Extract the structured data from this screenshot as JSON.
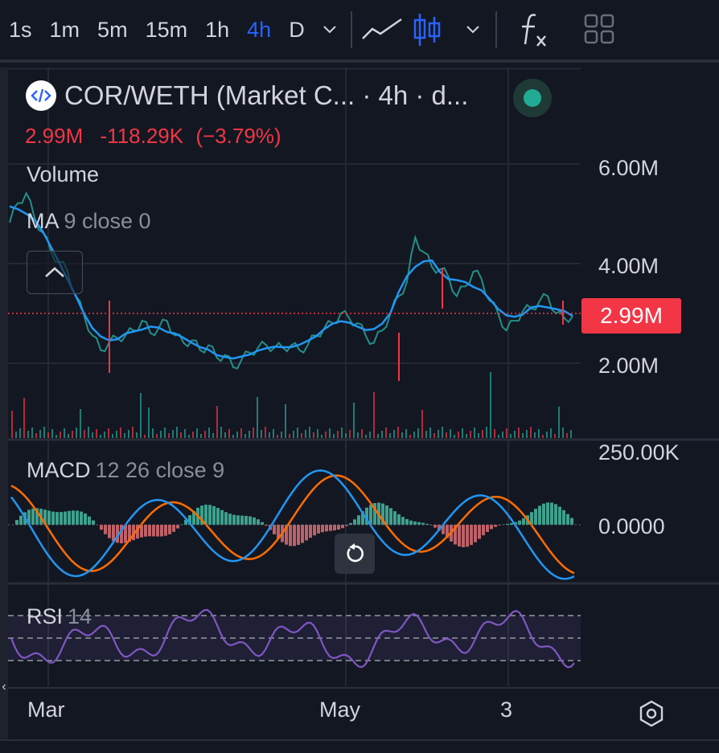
{
  "toolbar": {
    "timeframes": [
      "1s",
      "1m",
      "5m",
      "15m",
      "1h",
      "4h",
      "D"
    ],
    "active_timeframe": "4h"
  },
  "legend": {
    "title": "COR/WETH (Market C... · 4h · d...",
    "price": "2.99M",
    "change": "-118.29K",
    "change_pct": "(−3.79%)"
  },
  "indicators": {
    "volume": {
      "name": "Volume"
    },
    "ma": {
      "name": "MA",
      "params": "9 close 0"
    },
    "macd": {
      "name": "MACD",
      "params": "12 26 close 9"
    },
    "rsi": {
      "name": "RSI",
      "params": "14"
    }
  },
  "price_axis": {
    "ticks": [
      "6.00M",
      "4.00M",
      "2.00M"
    ],
    "current_price": "2.99M",
    "macd_ticks": [
      "250.00K",
      "0.0000"
    ]
  },
  "time_axis": {
    "labels": [
      "Mar",
      "May",
      "3"
    ]
  },
  "colors": {
    "background": "#131722",
    "up": "#26a69a",
    "down": "#f23645",
    "ma_line": "#2196f3",
    "macd_line": "#2196f3",
    "signal_line": "#ff6d00",
    "rsi_line": "#7e57c2",
    "accent": "#2962ff"
  },
  "chart_data": {
    "type": "line",
    "symbol": "COR/WETH",
    "interval": "4h",
    "price_series": {
      "name": "",
      "values": [
        4.9,
        5.3,
        5.5,
        5.0,
        4.7,
        4.3,
        4.1,
        3.9,
        3.4,
        3.0,
        2.6,
        2.3,
        2.45,
        2.55,
        2.6,
        2.7,
        2.9,
        2.65,
        2.75,
        2.9,
        2.6,
        2.45,
        2.5,
        2.3,
        2.4,
        2.15,
        2.2,
        1.95,
        2.1,
        2.25,
        2.35,
        2.4,
        2.35,
        2.35,
        2.4,
        2.3,
        2.4,
        2.6,
        2.75,
        2.85,
        3.05,
        2.95,
        2.85,
        2.6,
        2.45,
        2.7,
        3.05,
        3.4,
        3.7,
        4.6,
        4.3,
        4.0,
        3.95,
        3.8,
        3.4,
        3.6,
        3.9,
        3.75,
        3.3,
        3.05,
        2.7,
        2.9,
        3.1,
        3.15,
        3.3,
        3.4,
        3.05,
        2.95,
        2.99
      ]
    },
    "ylim": [
      0,
      7
    ],
    "yticks": [
      2,
      4,
      6
    ],
    "macd": {
      "ticks": [
        "250.00K",
        "0.0000"
      ]
    },
    "rsi": {
      "period": 14
    },
    "x_labels": [
      "Mar",
      "May",
      "3"
    ]
  }
}
